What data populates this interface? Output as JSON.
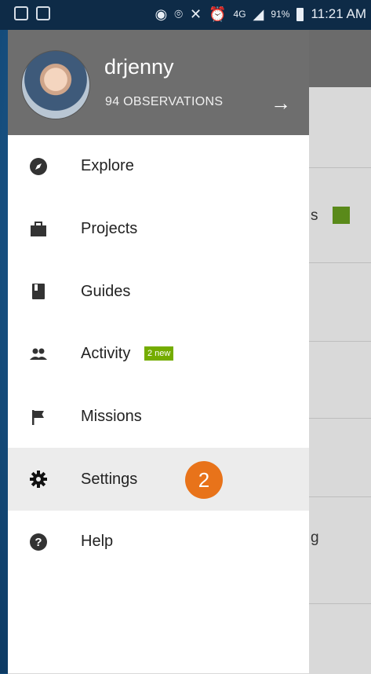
{
  "status_bar": {
    "battery_percent": "91%",
    "time": "11:21 AM",
    "network": "4G"
  },
  "profile": {
    "username": "drjenny",
    "observations": "94 OBSERVATIONS"
  },
  "menu": [
    {
      "label": "Explore",
      "icon": "compass-icon"
    },
    {
      "label": "Projects",
      "icon": "briefcase-icon"
    },
    {
      "label": "Guides",
      "icon": "book-icon"
    },
    {
      "label": "Activity",
      "icon": "people-icon",
      "badge": "2 new"
    },
    {
      "label": "Missions",
      "icon": "flag-icon"
    },
    {
      "label": "Settings",
      "icon": "gear-icon",
      "active": true
    },
    {
      "label": "Help",
      "icon": "help-icon"
    }
  ],
  "annotation": {
    "step_number": "2"
  },
  "background_fragments": {
    "row3_text": "s",
    "row7_text": "g"
  },
  "colors": {
    "badge_green": "#74ac00",
    "step_orange": "#e8731a",
    "header_gray": "#6e6e6e"
  }
}
